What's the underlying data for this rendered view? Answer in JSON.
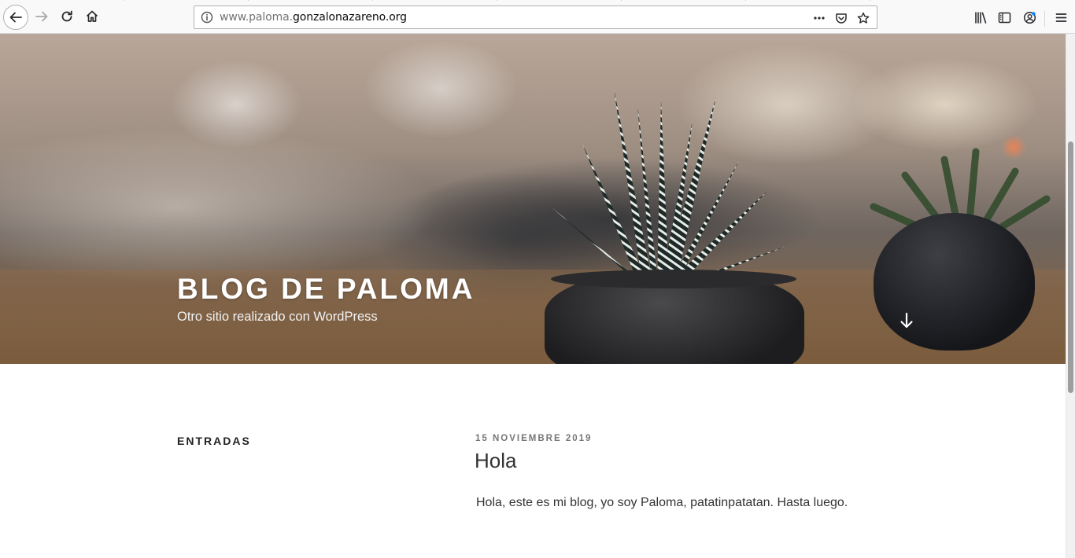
{
  "browser": {
    "url": {
      "prefix": "www.paloma.",
      "domain": "gonzalonazareno.org"
    },
    "icons": {
      "back": "back-arrow-icon",
      "forward": "forward-arrow-icon",
      "reload": "reload-icon",
      "home": "home-icon",
      "site_info": "info-icon",
      "page_actions": "more-dots-icon",
      "pocket": "pocket-icon",
      "bookmark": "star-icon",
      "library": "library-icon",
      "sidebar": "sidebar-icon",
      "account": "account-icon",
      "menu": "hamburger-menu-icon"
    }
  },
  "hero": {
    "site_title": "BLOG DE PALOMA",
    "tagline": "Otro sitio realizado con WordPress",
    "scroll_icon": "arrow-down-icon"
  },
  "content": {
    "sidebar_heading": "ENTRADAS",
    "post": {
      "date": "15 NOVIEMBRE 2019",
      "title": "Hola",
      "body": "Hola, este es mi blog, yo soy Paloma, patatinpatatan. Hasta luego."
    }
  },
  "colors": {
    "toolbar_bg": "#f9f9fa",
    "title_text": "#ffffff",
    "date_text": "#767676",
    "body_text": "#333333"
  }
}
